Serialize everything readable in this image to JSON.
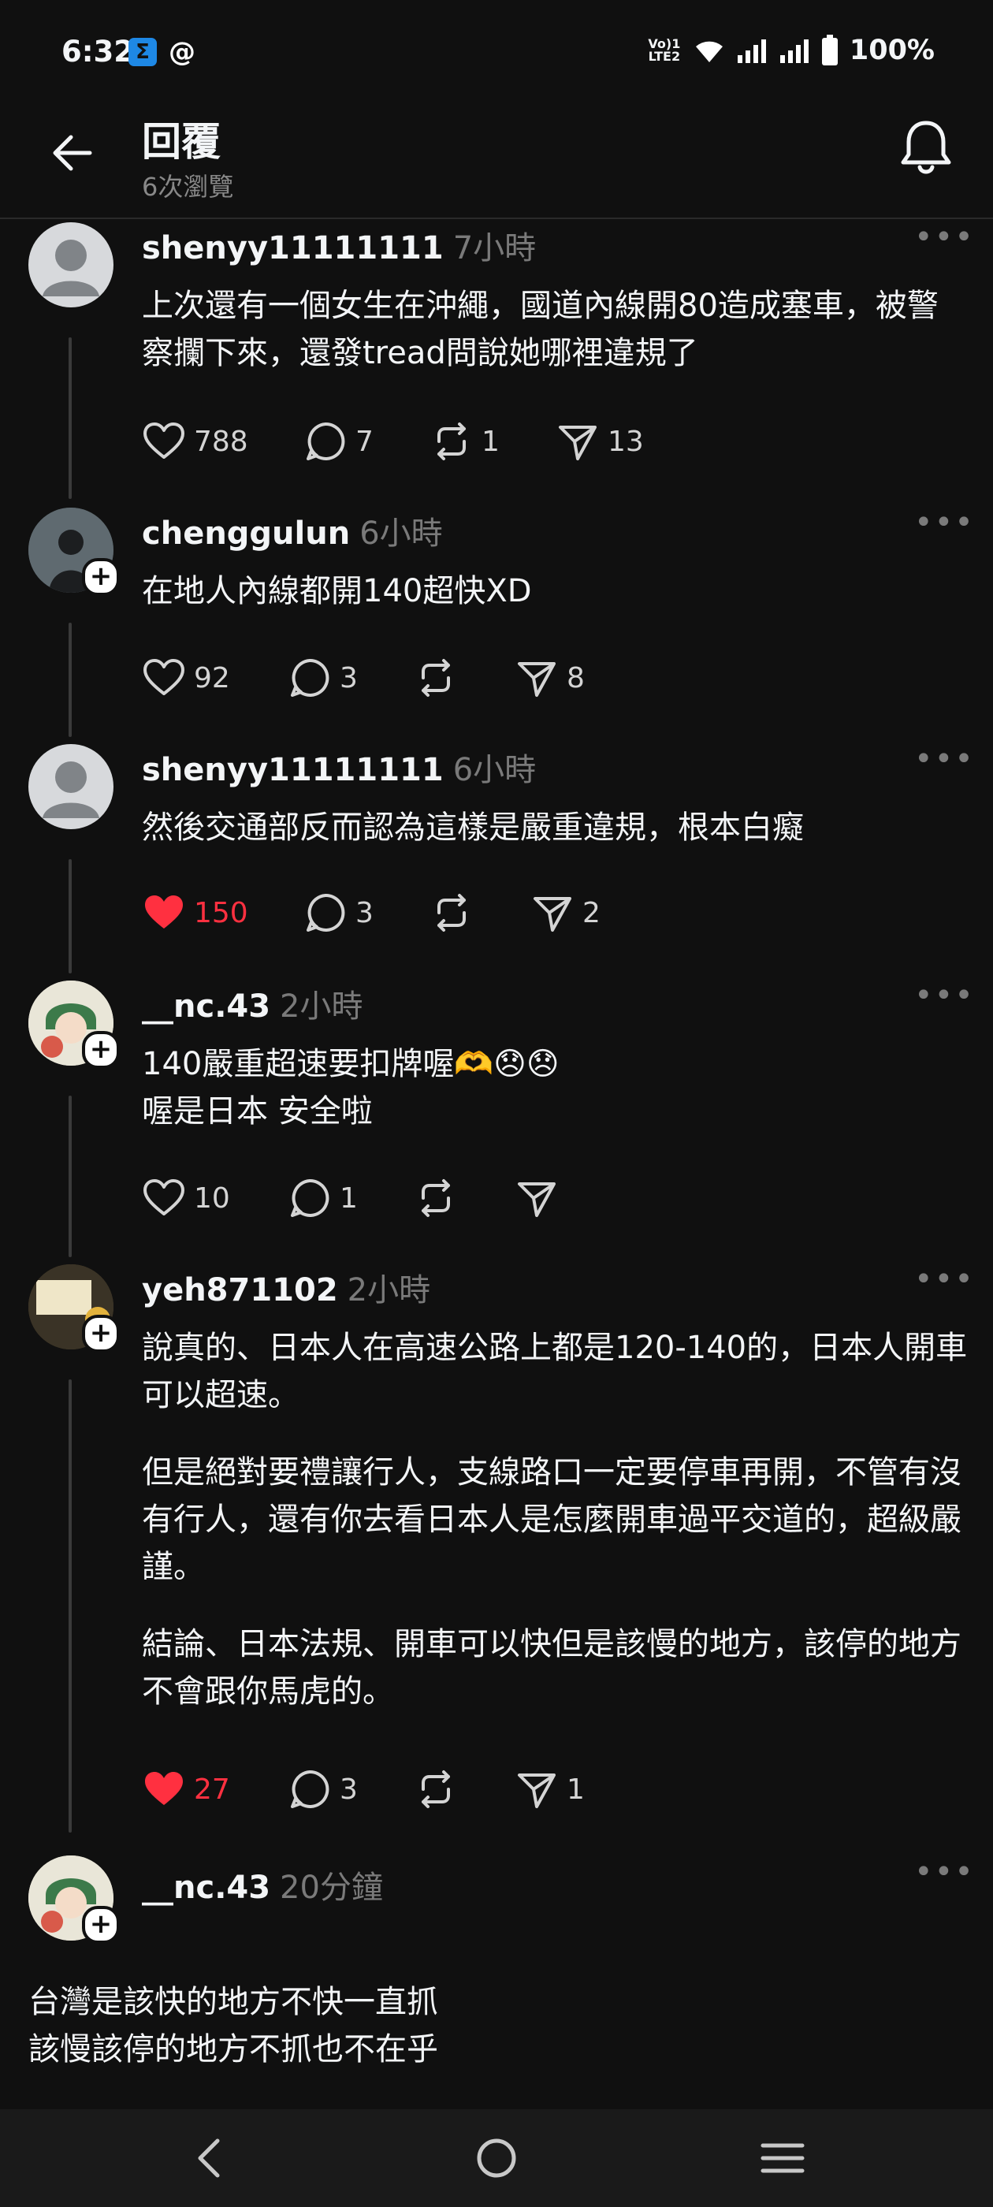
{
  "status_bar": {
    "time": "6:32",
    "app1": "Σ",
    "app2": "@",
    "volte": "Vo) 1 LTE2",
    "battery": "100%"
  },
  "header": {
    "title": "回覆",
    "views": "6次瀏覽"
  },
  "posts": [
    {
      "username": "shenyy11111111",
      "time": "7小時",
      "lines": [
        "上次還有一個女生在沖繩，國道內線開80造成塞車，被警察攔下來，還發tread問說她哪裡違規了"
      ],
      "likes": "788",
      "replies": "7",
      "reposts": "1",
      "shares": "13",
      "liked": false
    },
    {
      "username": "chenggulun",
      "time": "6小時",
      "lines": [
        "在地人內線都開140超快XD"
      ],
      "likes": "92",
      "replies": "3",
      "reposts": "",
      "shares": "8",
      "liked": false
    },
    {
      "username": "shenyy11111111",
      "time": "6小時",
      "lines": [
        "然後交通部反而認為這樣是嚴重違規，根本白癡"
      ],
      "likes": "150",
      "replies": "3",
      "reposts": "",
      "shares": "2",
      "liked": true
    },
    {
      "username": "__nc.43",
      "time": "2小時",
      "lines": [
        "140嚴重超速要扣牌喔🫶😞😞\n喔是日本 安全啦"
      ],
      "likes": "10",
      "replies": "1",
      "reposts": "",
      "shares": "",
      "liked": false
    },
    {
      "username": "yeh871102",
      "time": "2小時",
      "lines": [
        "說真的、日本人在高速公路上都是120-140的，日本人開車可以超速。",
        "但是絕對要禮讓行人，支線路口一定要停車再開，不管有沒有行人，還有你去看日本人是怎麼開車過平交道的，超級嚴謹。",
        "結論、日本法規、開車可以快但是該慢的地方，該停的地方不會跟你馬虎的。"
      ],
      "likes": "27",
      "replies": "3",
      "reposts": "",
      "shares": "1",
      "liked": true
    },
    {
      "username": "__nc.43",
      "time": "20分鐘",
      "lines": [
        "台灣是該快的地方不快一直抓\n該慢該停的地方不抓也不在乎"
      ]
    }
  ],
  "colors": {
    "background": "#101010",
    "liked": "#ff3040",
    "muted": "#7a7a7a"
  }
}
